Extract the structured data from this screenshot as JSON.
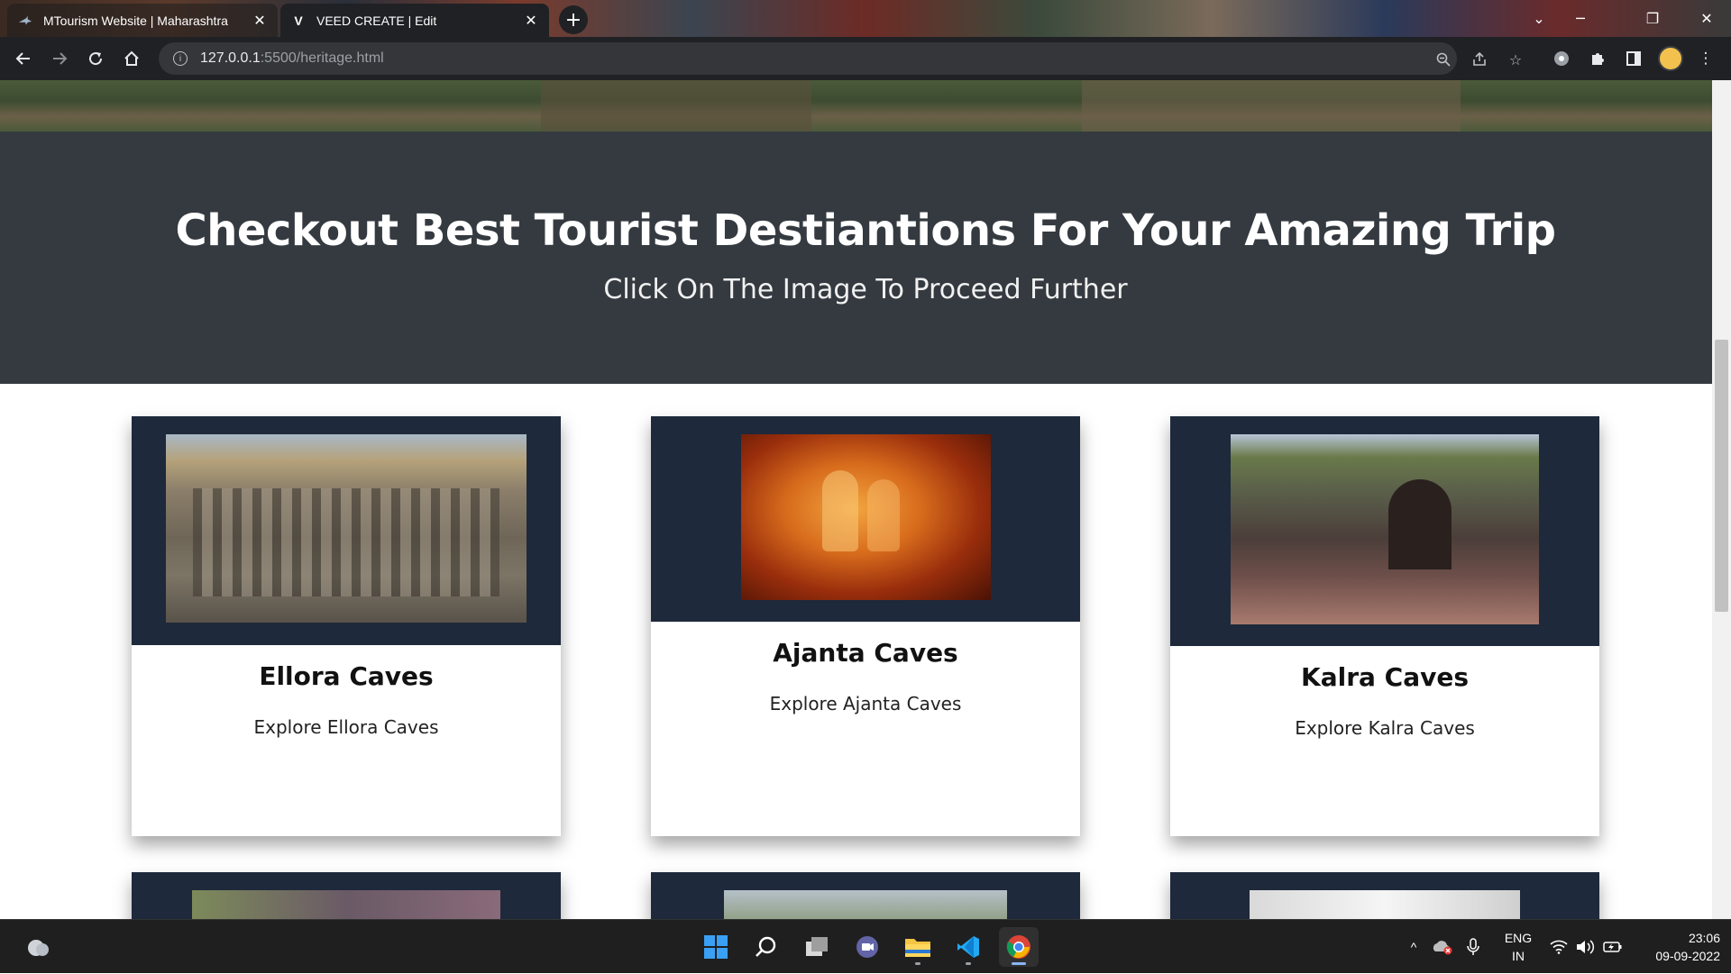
{
  "browser": {
    "tabs": [
      {
        "title": "MTourism Website | Maharashtra",
        "favicon": "shark-icon",
        "active": false
      },
      {
        "title": "VEED CREATE | Edit",
        "favicon": "V",
        "active": true
      }
    ],
    "new_tab_symbol": "+",
    "url_host": "127.0.0.1",
    "url_rest": ":5500/heritage.html"
  },
  "page": {
    "banner": {
      "title": "Checkout Best Tourist Destiantions For Your Amazing Trip",
      "subtitle": "Click On The Image To Proceed Further",
      "background": "#343a40"
    },
    "card_image_bg": "#1e293b",
    "cards": [
      {
        "title": "Ellora Caves",
        "description": "Explore Ellora Caves"
      },
      {
        "title": "Ajanta Caves",
        "description": "Explore Ajanta Caves"
      },
      {
        "title": "Kalra Caves",
        "description": "Explore Kalra Caves"
      }
    ]
  },
  "taskbar": {
    "language": [
      "ENG",
      "IN"
    ],
    "time": "23:06",
    "date": "09-09-2022"
  }
}
